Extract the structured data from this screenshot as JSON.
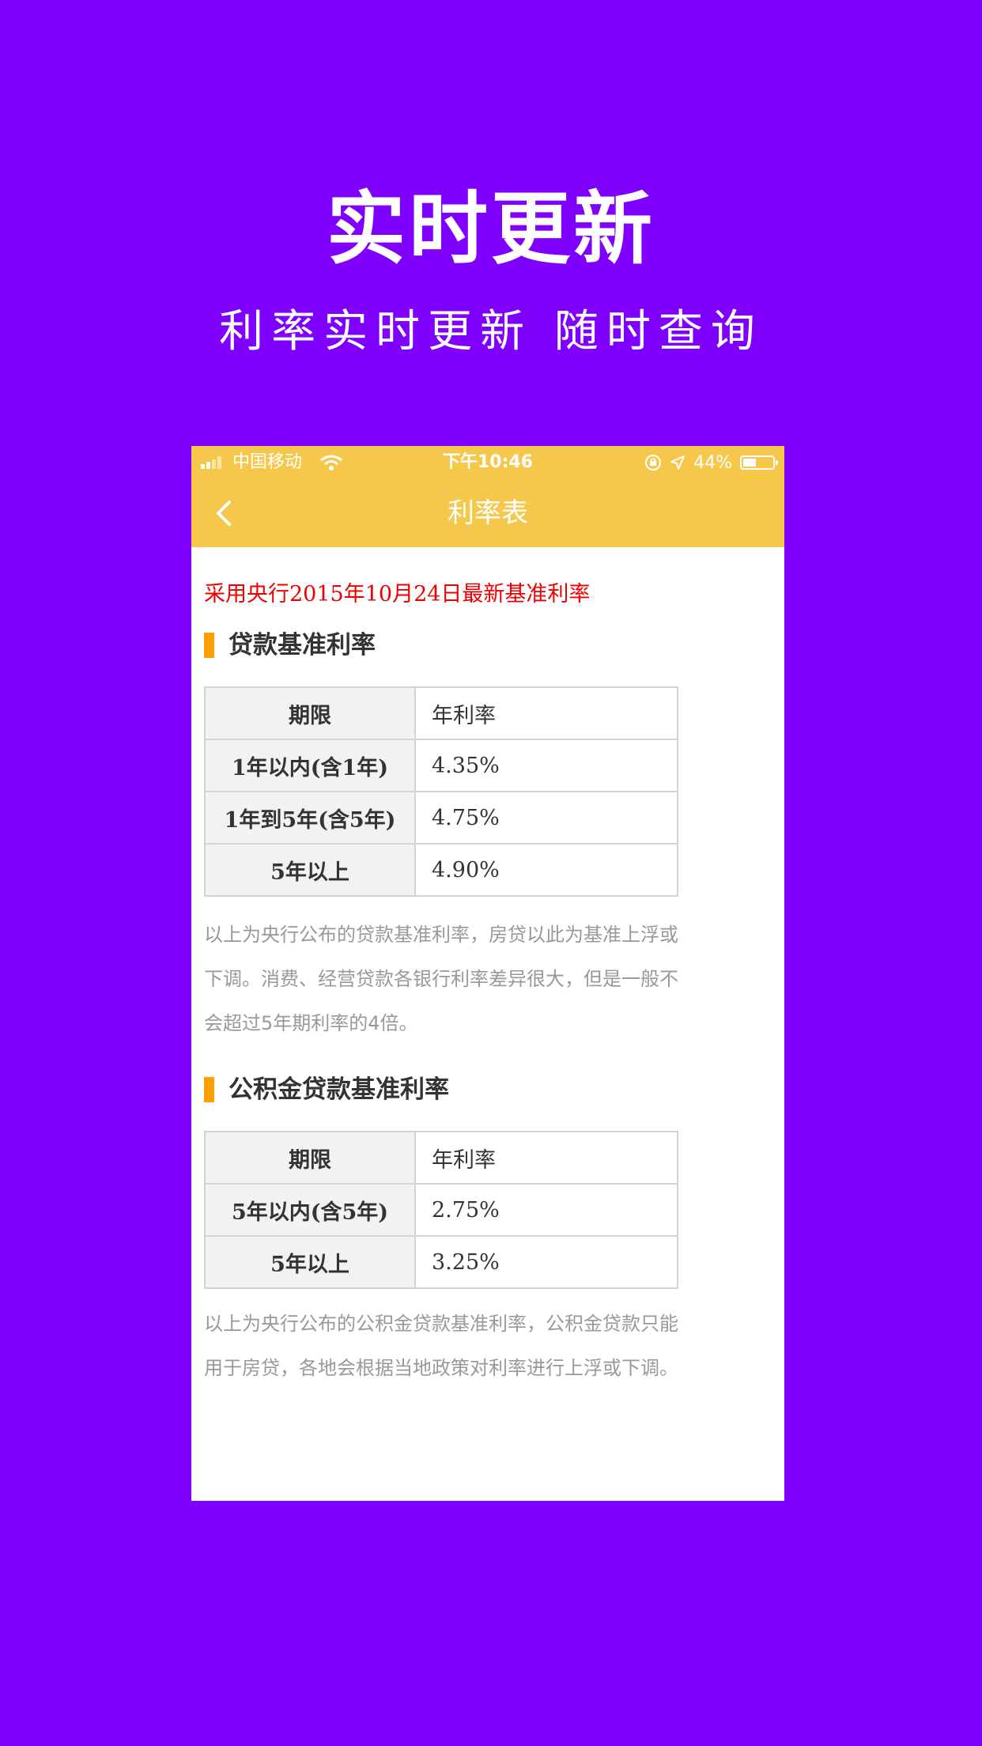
{
  "hero": {
    "title": "实时更新",
    "subtitle": "利率实时更新 随时查询"
  },
  "status_bar": {
    "carrier": "中国移动",
    "time": "下午10:46",
    "battery": "44%",
    "battery_level": 0.44
  },
  "nav": {
    "title": "利率表",
    "back_icon": "chevron-left-icon"
  },
  "notice": "采用央行2015年10月24日最新基准利率",
  "loan_section": {
    "title": "贷款基准利率",
    "header": {
      "term": "期限",
      "rate": "年利率"
    },
    "rows": [
      {
        "term": "1年以内(含1年)",
        "rate": "4.35%"
      },
      {
        "term": "1年到5年(含5年)",
        "rate": "4.75%"
      },
      {
        "term": "5年以上",
        "rate": "4.90%"
      }
    ],
    "note": "以上为央行公布的贷款基准利率，房贷以此为基准上浮或下调。消费、经营贷款各银行利率差异很大，但是一般不会超过5年期利率的4倍。"
  },
  "fund_section": {
    "title": "公积金贷款基准利率",
    "header": {
      "term": "期限",
      "rate": "年利率"
    },
    "rows": [
      {
        "term": "5年以内(含5年)",
        "rate": "2.75%"
      },
      {
        "term": "5年以上",
        "rate": "3.25%"
      }
    ],
    "note": "以上为央行公布的公积金贷款基准利率，公积金贷款只能用于房贷，各地会根据当地政策对利率进行上浮或下调。"
  },
  "colors": {
    "background": "#7f00ff",
    "header": "#f5c84b",
    "accent": "#ff9f00",
    "notice": "#ee0000"
  }
}
